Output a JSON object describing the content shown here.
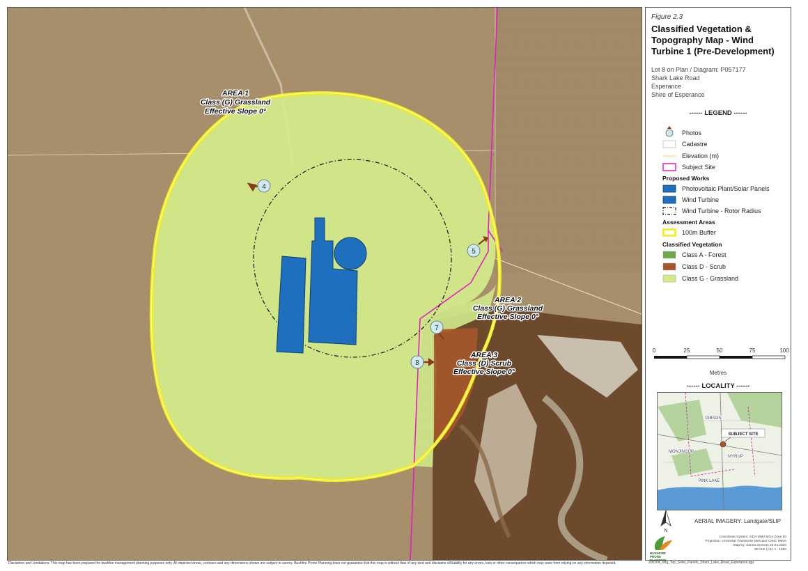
{
  "figure_number": "Figure 2.3",
  "title": "Classified Vegetation & Topography Map - Wind Turbine 1 (Pre-Development)",
  "address_lines": [
    "Lot 8 on Plan / Diagram: P057177",
    "Shark Lake Road",
    "Esperance",
    "Shire of Esperance"
  ],
  "legend": {
    "heading": "------ LEGEND ------",
    "photos": "Photos",
    "cadastre": "Cadastre",
    "elevation": "Elevation (m)",
    "subject_site": "Subject Site",
    "proposed_works_heading": "Proposed Works",
    "solar": "Photovoltaic Plant/Solar Panels",
    "wind_turbine": "Wind Turbine",
    "rotor_radius": "Wind Turbine - Rotor Radius",
    "assessment_heading": "Assessment Areas",
    "buffer": "100m Buffer",
    "vegetation_heading": "Classified Vegetation",
    "class_a": "Class A - Forest",
    "class_d": "Class D - Scrub",
    "class_g": "Class G - Grassland"
  },
  "scale": {
    "ticks": [
      "0",
      "25",
      "50",
      "75",
      "100"
    ],
    "unit": "Metres"
  },
  "locality": {
    "heading": "------ LOCALITY ------",
    "callout": "SUBJECT SITE",
    "place_names": [
      "GIBSON",
      "MONJINGUP",
      "MYRUP",
      "PINK LAKE"
    ]
  },
  "north": "N",
  "imagery_credit": "AERIAL IMAGERY: Landgate/SLIP",
  "logo_text": "BUSHFIRE PRONE PLANNING",
  "coordinate_info": [
    "Coordinate System: GDA 1994 MGA Zone 50",
    "Projection: Universal Transverse Mercator  Units: Metre",
    "Map by: Sarina German  23.04.2020",
    "SCALE (A3):  1 : 1500"
  ],
  "file_reference": "200204_Veg_Top_Solar_Panels_Shark_Lake_Road_Esperance.qgz",
  "disclaimer": "Disclaimer and Limitations: This map has been prepared for bushfire management planning purposes only. All depicted areas, contours and any dimensions shown are subject to survey. Bushfire Prone Planning does not guarantee that this map is without flaw of any kind and disclaims all liability for any errors, loss or other consequence which may arise from relying on any information depicted.",
  "areas": [
    {
      "name": "AREA  1",
      "class": "Class (G)  Grassland",
      "slope": "Effective Slope 0°"
    },
    {
      "name": "AREA  2",
      "class": "Class (G)  Grassland",
      "slope": "Effective Slope 0°"
    },
    {
      "name": "AREA  3",
      "class": "Class (D)  Scrub",
      "slope": "Effective Slope 0°"
    }
  ],
  "photos": [
    "4",
    "5",
    "7",
    "8"
  ],
  "colors": {
    "grassland": "#d3ec8a",
    "scrub": "#a5562a",
    "forest": "#6fa84a",
    "buffer": "#f2ee16",
    "subject_site": "#e020c0",
    "works": "#1f6fbf",
    "paddock": "#a88f6c"
  }
}
